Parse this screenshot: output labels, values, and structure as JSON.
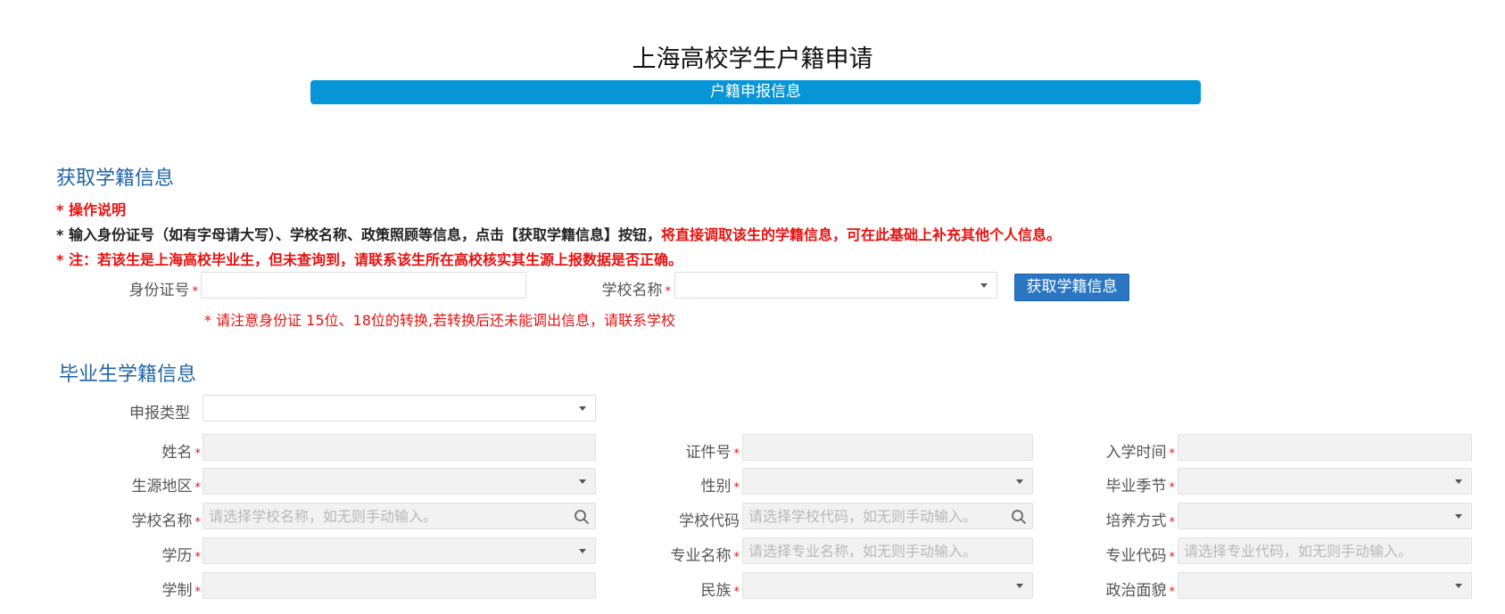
{
  "header": {
    "title": "上海高校学生户籍申请",
    "banner": "户籍申报信息"
  },
  "fetch_section": {
    "title": "获取学籍信息",
    "notes": {
      "line1": "* 操作说明",
      "line2_a": "* 输入身份证号（如有字母请大写）、学校名称、政策照顾等信息，点击【获取学籍信息】按钮，",
      "line2_b": "将直接调取该生的学籍信息，可在此基础上补充其他个人信息。",
      "line3": "* 注：若该生是上海高校毕业生，但未查询到，请联系该生所在高校核实其生源上报数据是否正确。"
    },
    "id_label": "身份证号",
    "school_label": "学校名称",
    "button_label": "获取学籍信息",
    "hint": "* 请注意身份证 15位、18位的转换,若转换后还未能调出信息，请联系学校"
  },
  "grad_section": {
    "title": "毕业生学籍信息",
    "declare_type_label": "申报类型",
    "name_label": "姓名",
    "cert_no_label": "证件号",
    "enroll_time_label": "入学时间",
    "origin_label": "生源地区",
    "gender_label": "性别",
    "grad_season_label": "毕业季节",
    "school_name_label": "学校名称",
    "school_name_placeholder": "请选择学校名称，如无则手动输入。",
    "school_code_label": "学校代码",
    "school_code_placeholder": "请选择学校代码，如无则手动输入。",
    "training_label": "培养方式",
    "education_label": "学历",
    "major_name_label": "专业名称",
    "major_name_placeholder": "请选择专业名称，如无则手动输入。",
    "major_code_label": "专业代码",
    "major_code_placeholder": "请选择专业代码，如无则手动输入。",
    "duration_label": "学制",
    "ethnicity_label": "民族",
    "political_label": "政治面貌"
  },
  "required_mark": "*"
}
